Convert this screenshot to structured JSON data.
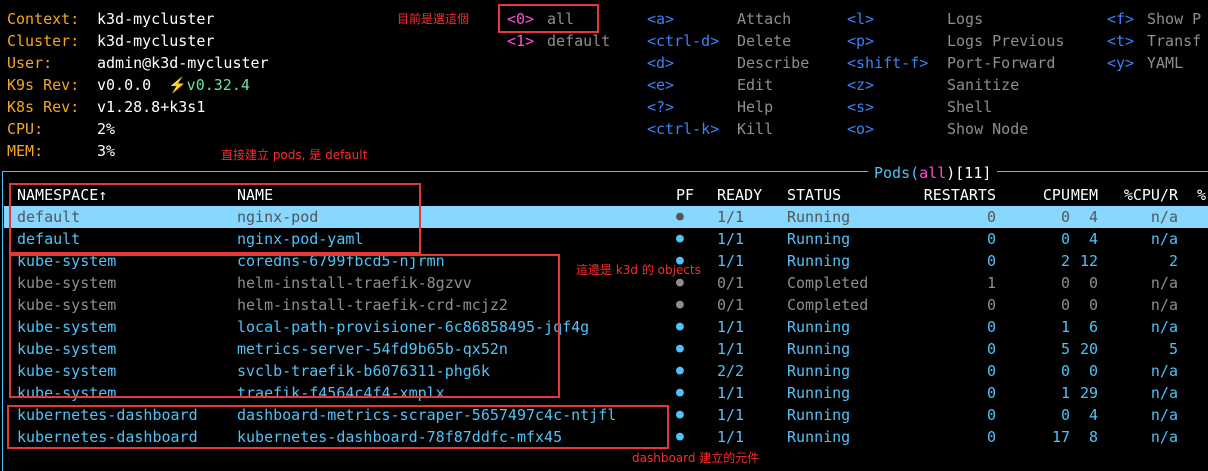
{
  "info": [
    {
      "label": "Context:",
      "value": "k3d-mycluster"
    },
    {
      "label": "Cluster:",
      "value": "k3d-mycluster"
    },
    {
      "label": "User:",
      "value": "admin@k3d-mycluster"
    },
    {
      "label": "K9s Rev:",
      "value": "v0.0.0",
      "extra": "⚡️v0.32.4"
    },
    {
      "label": "K8s Rev:",
      "value": "v1.28.8+k3s1"
    },
    {
      "label": "CPU:",
      "value": "2%"
    },
    {
      "label": "MEM:",
      "value": "3%"
    }
  ],
  "namespaces": [
    {
      "key": "<0>",
      "name": "all"
    },
    {
      "key": "<1>",
      "name": "default"
    }
  ],
  "shortcuts_col1": [
    {
      "key": "<a>",
      "action": "Attach"
    },
    {
      "key": "<ctrl-d>",
      "action": "Delete"
    },
    {
      "key": "<d>",
      "action": "Describe"
    },
    {
      "key": "<e>",
      "action": "Edit"
    },
    {
      "key": "<?>",
      "action": "Help"
    },
    {
      "key": "<ctrl-k>",
      "action": "Kill"
    }
  ],
  "shortcuts_col2": [
    {
      "key": "<l>",
      "action": "Logs"
    },
    {
      "key": "<p>",
      "action": "Logs Previous"
    },
    {
      "key": "<shift-f>",
      "action": "Port-Forward"
    },
    {
      "key": "<z>",
      "action": "Sanitize"
    },
    {
      "key": "<s>",
      "action": "Shell"
    },
    {
      "key": "<o>",
      "action": "Show Node"
    }
  ],
  "shortcuts_col3": [
    {
      "key": "<f>",
      "action": "Show P"
    },
    {
      "key": "<t>",
      "action": "Transf"
    },
    {
      "key": "<y>",
      "action": "YAML"
    }
  ],
  "pods_title": {
    "prefix": "Pods(",
    "filter": "all",
    "suffix": ")[11]"
  },
  "table": {
    "headers": {
      "namespace": "NAMESPACE↑",
      "name": "NAME",
      "pf": "PF",
      "ready": "READY",
      "status": "STATUS",
      "restarts": "RESTARTS",
      "cpu": "CPU",
      "mem": "MEM",
      "cpur": "%CPU/R",
      "extra": "%"
    },
    "rows": [
      {
        "namespace": "default",
        "name": "nginx-pod",
        "pf": "●",
        "ready": "1/1",
        "status": "Running",
        "restarts": "0",
        "cpu": "0",
        "mem": "4",
        "cpur": "n/a",
        "state": "selected"
      },
      {
        "namespace": "default",
        "name": "nginx-pod-yaml",
        "pf": "●",
        "ready": "1/1",
        "status": "Running",
        "restarts": "0",
        "cpu": "0",
        "mem": "4",
        "cpur": "n/a",
        "state": "running"
      },
      {
        "namespace": "kube-system",
        "name": "coredns-6799fbcd5-njrmn",
        "pf": "●",
        "ready": "1/1",
        "status": "Running",
        "restarts": "0",
        "cpu": "2",
        "mem": "12",
        "cpur": "2",
        "state": "running"
      },
      {
        "namespace": "kube-system",
        "name": "helm-install-traefik-8gzvv",
        "pf": "●",
        "ready": "0/1",
        "status": "Completed",
        "restarts": "1",
        "cpu": "0",
        "mem": "0",
        "cpur": "n/a",
        "state": "completed"
      },
      {
        "namespace": "kube-system",
        "name": "helm-install-traefik-crd-mcjz2",
        "pf": "●",
        "ready": "0/1",
        "status": "Completed",
        "restarts": "0",
        "cpu": "0",
        "mem": "0",
        "cpur": "n/a",
        "state": "completed"
      },
      {
        "namespace": "kube-system",
        "name": "local-path-provisioner-6c86858495-jqf4g",
        "pf": "●",
        "ready": "1/1",
        "status": "Running",
        "restarts": "0",
        "cpu": "1",
        "mem": "6",
        "cpur": "n/a",
        "state": "running"
      },
      {
        "namespace": "kube-system",
        "name": "metrics-server-54fd9b65b-qx52n",
        "pf": "●",
        "ready": "1/1",
        "status": "Running",
        "restarts": "0",
        "cpu": "5",
        "mem": "20",
        "cpur": "5",
        "state": "running"
      },
      {
        "namespace": "kube-system",
        "name": "svclb-traefik-b6076311-phg6k",
        "pf": "●",
        "ready": "2/2",
        "status": "Running",
        "restarts": "0",
        "cpu": "0",
        "mem": "0",
        "cpur": "n/a",
        "state": "running"
      },
      {
        "namespace": "kube-system",
        "name": "traefik-f4564c4f4-xmplx",
        "pf": "●",
        "ready": "1/1",
        "status": "Running",
        "restarts": "0",
        "cpu": "1",
        "mem": "29",
        "cpur": "n/a",
        "state": "running"
      },
      {
        "namespace": "kubernetes-dashboard",
        "name": "dashboard-metrics-scraper-5657497c4c-ntjfl",
        "pf": "●",
        "ready": "1/1",
        "status": "Running",
        "restarts": "0",
        "cpu": "0",
        "mem": "4",
        "cpur": "n/a",
        "state": "running"
      },
      {
        "namespace": "kubernetes-dashboard",
        "name": "kubernetes-dashboard-78f87ddfc-mfx45",
        "pf": "●",
        "ready": "1/1",
        "status": "Running",
        "restarts": "0",
        "cpu": "17",
        "mem": "8",
        "cpur": "n/a",
        "state": "running"
      }
    ]
  },
  "annotations": {
    "current_selection": "目前是選這個",
    "created_pods": "直接建立 pods, 是 default",
    "k3d_objects": "這邊是 k3d 的 objects",
    "dashboard": "dashboard 建立的元件"
  },
  "colors": {
    "label": "#f5a623",
    "key": "#3b82f6",
    "running": "#4fc3f7",
    "completed": "#8e8e8e",
    "selected_row": "#87d7ff",
    "annotation": "#e53935"
  }
}
